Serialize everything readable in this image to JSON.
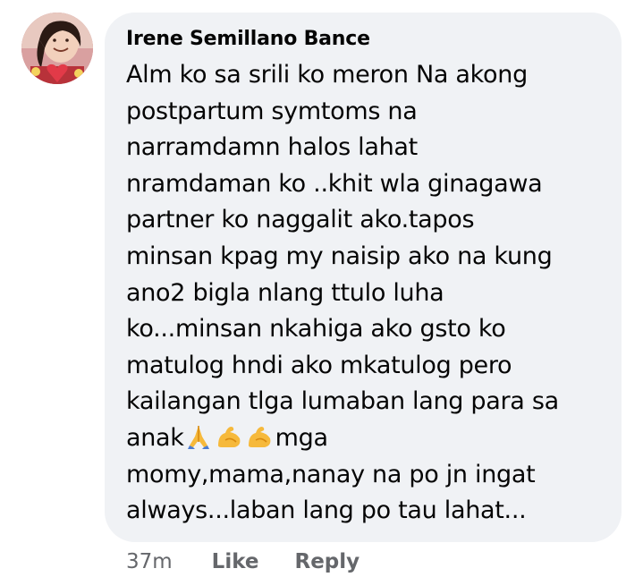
{
  "comment": {
    "author": "Irene Semillano Bance",
    "avatar_icon": "profile-photo-avatar",
    "lines": [
      "Alm ko sa srili ko meron Na akong",
      "postpartum symtoms na",
      "narramdamn halos lahat",
      "nramdaman ko ..khit wla ginagawa",
      "partner ko naggalit ako.tapos",
      "minsan kpag my naisip ako na kung",
      "ano2 bigla nlang ttulo luha",
      "ko...minsan nkahiga ako gsto ko",
      "matulog hndi ako mkatulog pero",
      "kailangan tlga lumaban lang para sa"
    ],
    "emoji_line": {
      "prefix": "anak",
      "emojis": [
        "folded-hands-emoji",
        "flexed-biceps-emoji",
        "flexed-biceps-emoji"
      ],
      "suffix": "mga"
    },
    "lines_after": [
      "momy,mama,nanay na po jn ingat",
      "always...laban lang po tau lahat..."
    ],
    "timestamp": "37m",
    "like_label": "Like",
    "reply_label": "Reply"
  },
  "colors": {
    "bubble_bg": "#f0f2f5",
    "text": "#050505",
    "meta_text": "#65676b"
  }
}
